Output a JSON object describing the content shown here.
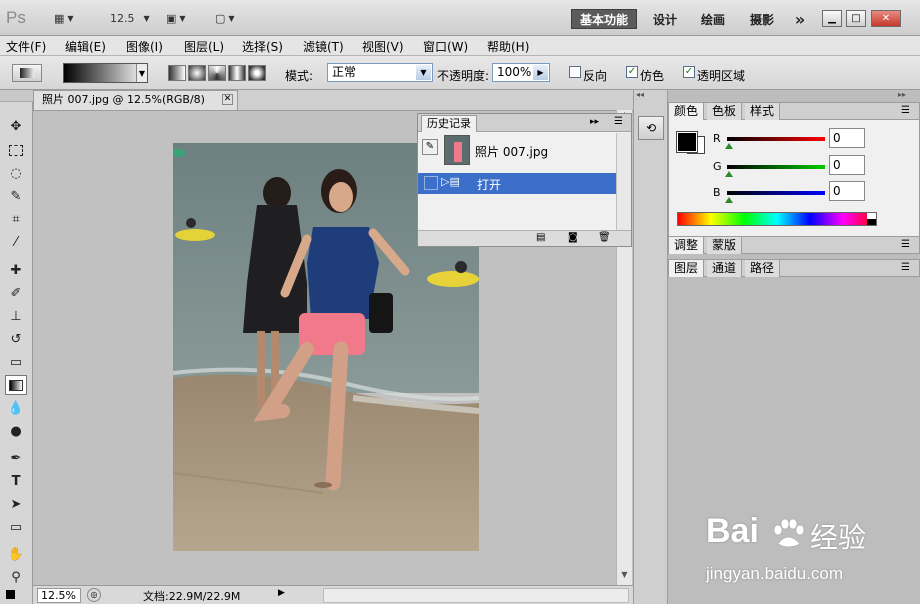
{
  "app": {
    "logo": "Ps",
    "zoom_dropdown": "12.5",
    "workspaces": [
      "基本功能",
      "设计",
      "绘画",
      "摄影"
    ],
    "active_workspace": "基本功能",
    "more": "»"
  },
  "menu": [
    "文件(F)",
    "编辑(E)",
    "图像(I)",
    "图层(L)",
    "选择(S)",
    "滤镜(T)",
    "视图(V)",
    "窗口(W)",
    "帮助(H)"
  ],
  "options": {
    "mode_label": "模式:",
    "mode_value": "正常",
    "opacity_label": "不透明度:",
    "opacity_value": "100%",
    "reverse_label": "反向",
    "reverse_checked": false,
    "dither_label": "仿色",
    "dither_checked": true,
    "transparency_label": "透明区域",
    "transparency_checked": true
  },
  "document": {
    "tab_title": "照片 007.jpg @ 12.5%(RGB/8)",
    "status_zoom": "12.5%",
    "status_info": "文档:22.9M/22.9M"
  },
  "history": {
    "tab": "历史记录",
    "snapshot_name": "照片 007.jpg",
    "states": [
      "打开"
    ]
  },
  "color": {
    "tabs": [
      "颜色",
      "色板",
      "样式"
    ],
    "r_label": "R",
    "g_label": "G",
    "b_label": "B",
    "r": "0",
    "g": "0",
    "b": "0",
    "foreground": "#000000",
    "background": "#ffffff"
  },
  "adjust_tabs": [
    "调整",
    "蒙版"
  ],
  "layer_tabs": [
    "图层",
    "通道",
    "路径"
  ],
  "watermark": {
    "brand": "Bai",
    "brand2": "经验",
    "url": "jingyan.baidu.com"
  }
}
